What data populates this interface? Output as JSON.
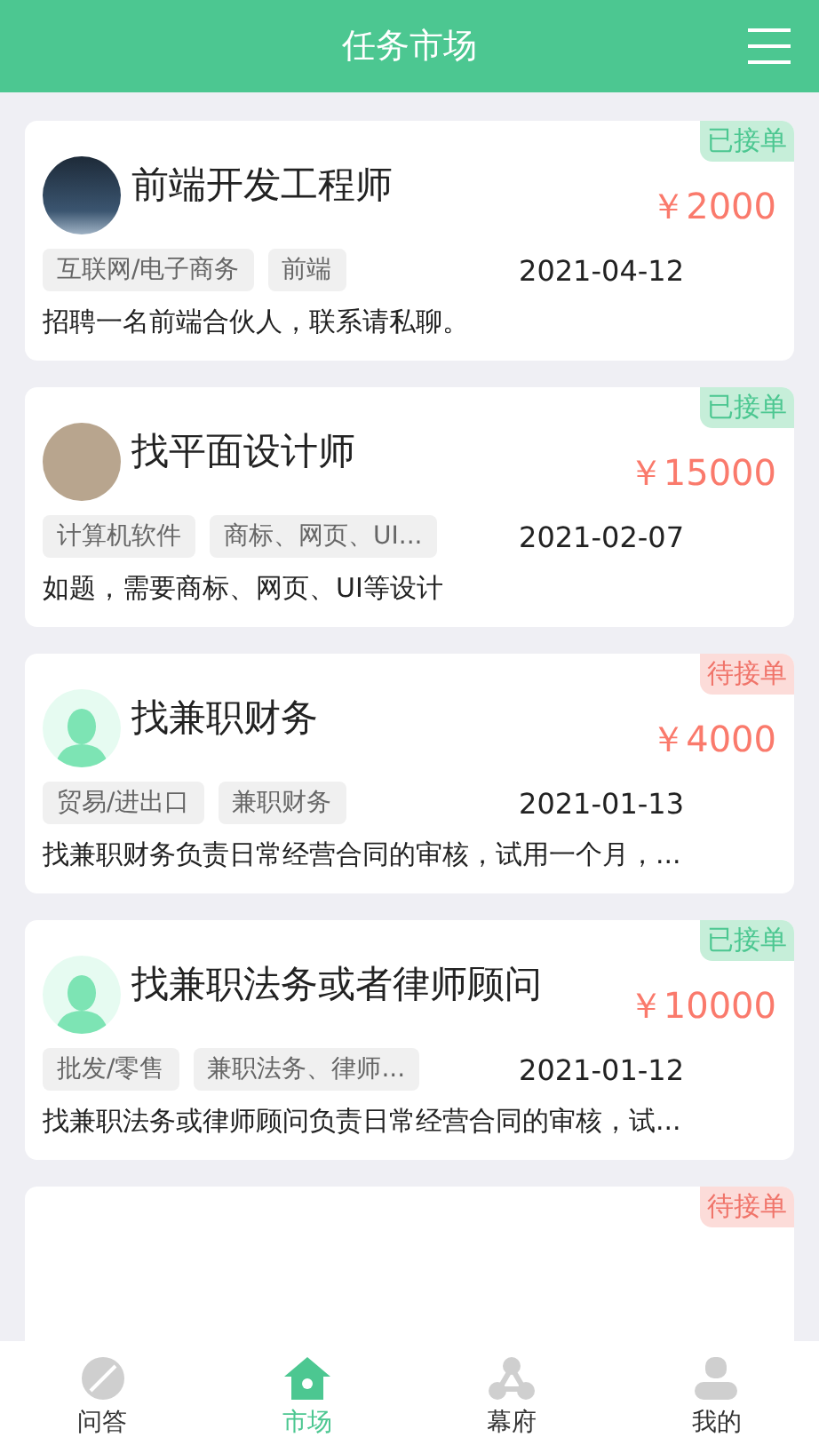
{
  "header": {
    "title": "任务市场"
  },
  "tasks": [
    {
      "status": {
        "kind": "taken",
        "label": "已接单"
      },
      "avatar": {
        "kind": "photo-dark"
      },
      "title": "前端开发工程师",
      "price": "￥2000",
      "tags": [
        "互联网/电子商务",
        "前端"
      ],
      "date": "2021-04-12",
      "description": "招聘一名前端合伙人，联系请私聊。"
    },
    {
      "status": {
        "kind": "taken",
        "label": "已接单"
      },
      "avatar": {
        "kind": "photo-light"
      },
      "title": "找平面设计师",
      "price": "￥15000",
      "tags": [
        "计算机软件",
        "商标、网页、UI..."
      ],
      "date": "2021-02-07",
      "description": "如题，需要商标、网页、UI等设计"
    },
    {
      "status": {
        "kind": "pending",
        "label": "待接单"
      },
      "avatar": {
        "kind": "default"
      },
      "title": "找兼职财务",
      "price": "￥4000",
      "tags": [
        "贸易/进出口",
        "兼职财务"
      ],
      "date": "2021-01-13",
      "description": "找兼职财务负责日常经营合同的审核，试用一个月，..."
    },
    {
      "status": {
        "kind": "taken",
        "label": "已接单"
      },
      "avatar": {
        "kind": "default"
      },
      "title": "找兼职法务或者律师顾问",
      "price": "￥10000",
      "tags": [
        "批发/零售",
        "兼职法务、律师..."
      ],
      "date": "2021-01-12",
      "description": "找兼职法务或律师顾问负责日常经营合同的审核，试..."
    },
    {
      "status": {
        "kind": "pending",
        "label": "待接单"
      }
    }
  ],
  "tabbar": [
    {
      "kind": "qa",
      "label": "问答",
      "selected": false
    },
    {
      "kind": "market",
      "label": "市场",
      "selected": true
    },
    {
      "kind": "network",
      "label": "幕府",
      "selected": false
    },
    {
      "kind": "me",
      "label": "我的",
      "selected": false
    }
  ]
}
